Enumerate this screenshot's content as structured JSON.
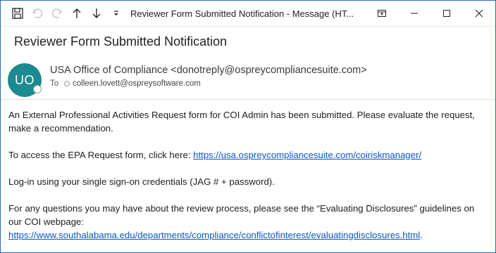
{
  "window": {
    "title": "Reviewer Form Submitted Notification  -  Message (HT..."
  },
  "subject": "Reviewer Form Submitted Notification",
  "sender": {
    "initials": "UO",
    "display": "USA Office of Compliance <donotreply@ospreycompliancesuite.com>",
    "to_label": "To",
    "to": "colleen.lovett@ospreysoftware.com",
    "avatar_color": "#1c8a91"
  },
  "body": {
    "p1": "An External Professional Activities Request form for COI Admin has been submitted. Please evaluate the request, make a recommendation.",
    "p2_text": "To access the EPA Request form, click here: ",
    "p2_link": "https://usa.ospreycompliancesuite.com/coiriskmanager/",
    "p3": "Log-in using your single sign-on credentials (JAG # + password).",
    "p4_text": "For any questions you may have about the review process, please see the “Evaluating Disclosures” guidelines on our COI webpage:",
    "p4_link": "https://www.southalabama.edu/departments/compliance/conflictofinterest/evaluatingdisclosures.html",
    "p4_end": "."
  },
  "colors": {
    "link": "#0b56c2",
    "frame": "#2b6cb0"
  }
}
